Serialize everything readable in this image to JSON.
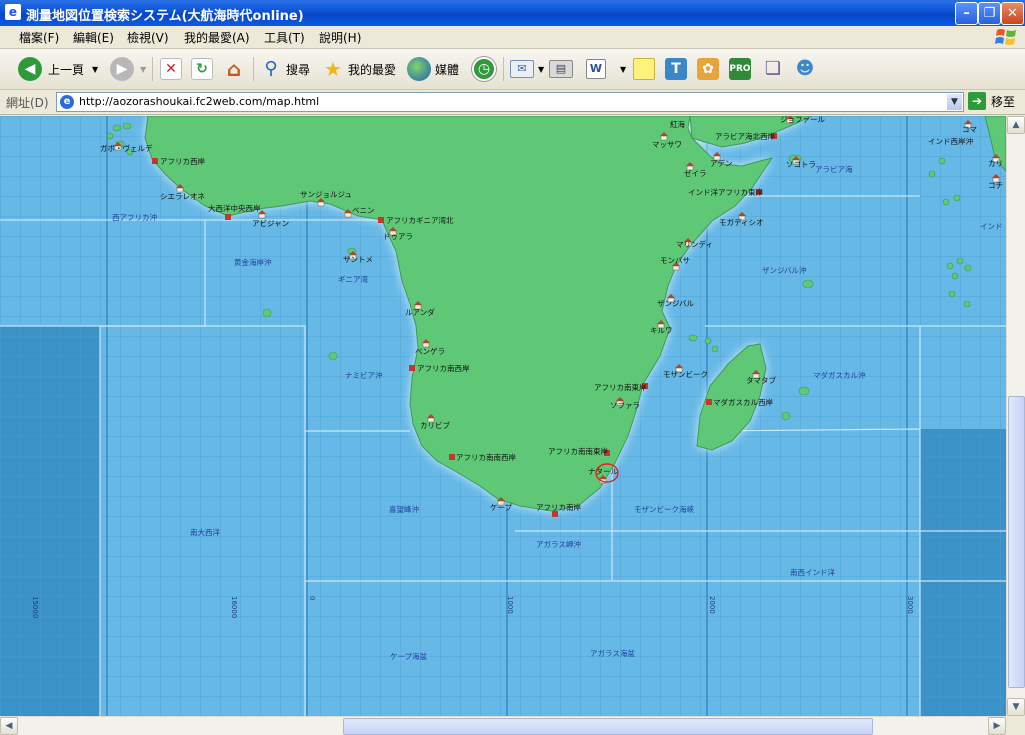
{
  "window": {
    "title": "測量地図位置検索システム(大航海時代online)"
  },
  "menu": [
    "檔案(F)",
    "編輯(E)",
    "檢視(V)",
    "我的最愛(A)",
    "工具(T)",
    "說明(H)"
  ],
  "toolbar": {
    "back": "上一頁",
    "search": "搜尋",
    "favorites": "我的最愛",
    "media": "媒體"
  },
  "address": {
    "label": "網址(D)",
    "url": "http://aozorashoukai.fc2web.com/map.html",
    "go": "移至"
  },
  "map": {
    "colors": {
      "sea": "#66b8e6",
      "deep_sea": "#3a92c6",
      "land": "#5fc877",
      "port": "#c0392b"
    },
    "grid_labels": [
      "15000",
      "16000",
      "0",
      "1000",
      "2000",
      "3000"
    ],
    "ports": [
      {
        "name": "ガボ・ヴェルデ"
      },
      {
        "name": "アフリカ西岸"
      },
      {
        "name": "シエラレオネ"
      },
      {
        "name": "大西洋中央西岸"
      },
      {
        "name": "アビジャン"
      },
      {
        "name": "サンジョルジュ"
      },
      {
        "name": "ベニン"
      },
      {
        "name": "アフリカギニア湾北"
      },
      {
        "name": "ドゥアラ"
      },
      {
        "name": "サントメ"
      },
      {
        "name": "ルアンダ"
      },
      {
        "name": "ベンゲラ"
      },
      {
        "name": "アフリカ南西岸"
      },
      {
        "name": "カリビブ"
      },
      {
        "name": "アフリカ南南西岸"
      },
      {
        "name": "ケープ"
      },
      {
        "name": "アフリカ南岸"
      },
      {
        "name": "アフリカ南南東岸"
      },
      {
        "name": "ナタール"
      },
      {
        "name": "ソファラ"
      },
      {
        "name": "アフリカ南東岸"
      },
      {
        "name": "モザンビーク"
      },
      {
        "name": "キルワ"
      },
      {
        "name": "ザンジバル"
      },
      {
        "name": "モンバサ"
      },
      {
        "name": "マリンディ"
      },
      {
        "name": "モガディシオ"
      },
      {
        "name": "インド洋アフリカ東岸"
      },
      {
        "name": "アデン"
      },
      {
        "name": "ゼイラ"
      },
      {
        "name": "マッサワ"
      },
      {
        "name": "紅海"
      },
      {
        "name": "アラビア海北西岸"
      },
      {
        "name": "ジョファール"
      },
      {
        "name": "ソコトラ"
      },
      {
        "name": "タマタブ"
      },
      {
        "name": "マダガスカル西岸"
      },
      {
        "name": "インド西岸沖"
      },
      {
        "name": "コマ"
      },
      {
        "name": "カリ"
      },
      {
        "name": "コチ"
      }
    ],
    "sea_areas": [
      {
        "name": "西アフリカ沖"
      },
      {
        "name": "黄金海岸沖"
      },
      {
        "name": "ギニア湾"
      },
      {
        "name": "ナミビア沖"
      },
      {
        "name": "喜望峰沖"
      },
      {
        "name": "南大西洋"
      },
      {
        "name": "アガラス岬沖"
      },
      {
        "name": "モザンビーク海峡"
      },
      {
        "name": "ザンジバル沖"
      },
      {
        "name": "マダガスカル沖"
      },
      {
        "name": "アラビア海"
      },
      {
        "name": "インド"
      },
      {
        "name": "南西インド洋"
      },
      {
        "name": "ケープ海盆"
      },
      {
        "name": "アガラス海盆"
      }
    ]
  }
}
